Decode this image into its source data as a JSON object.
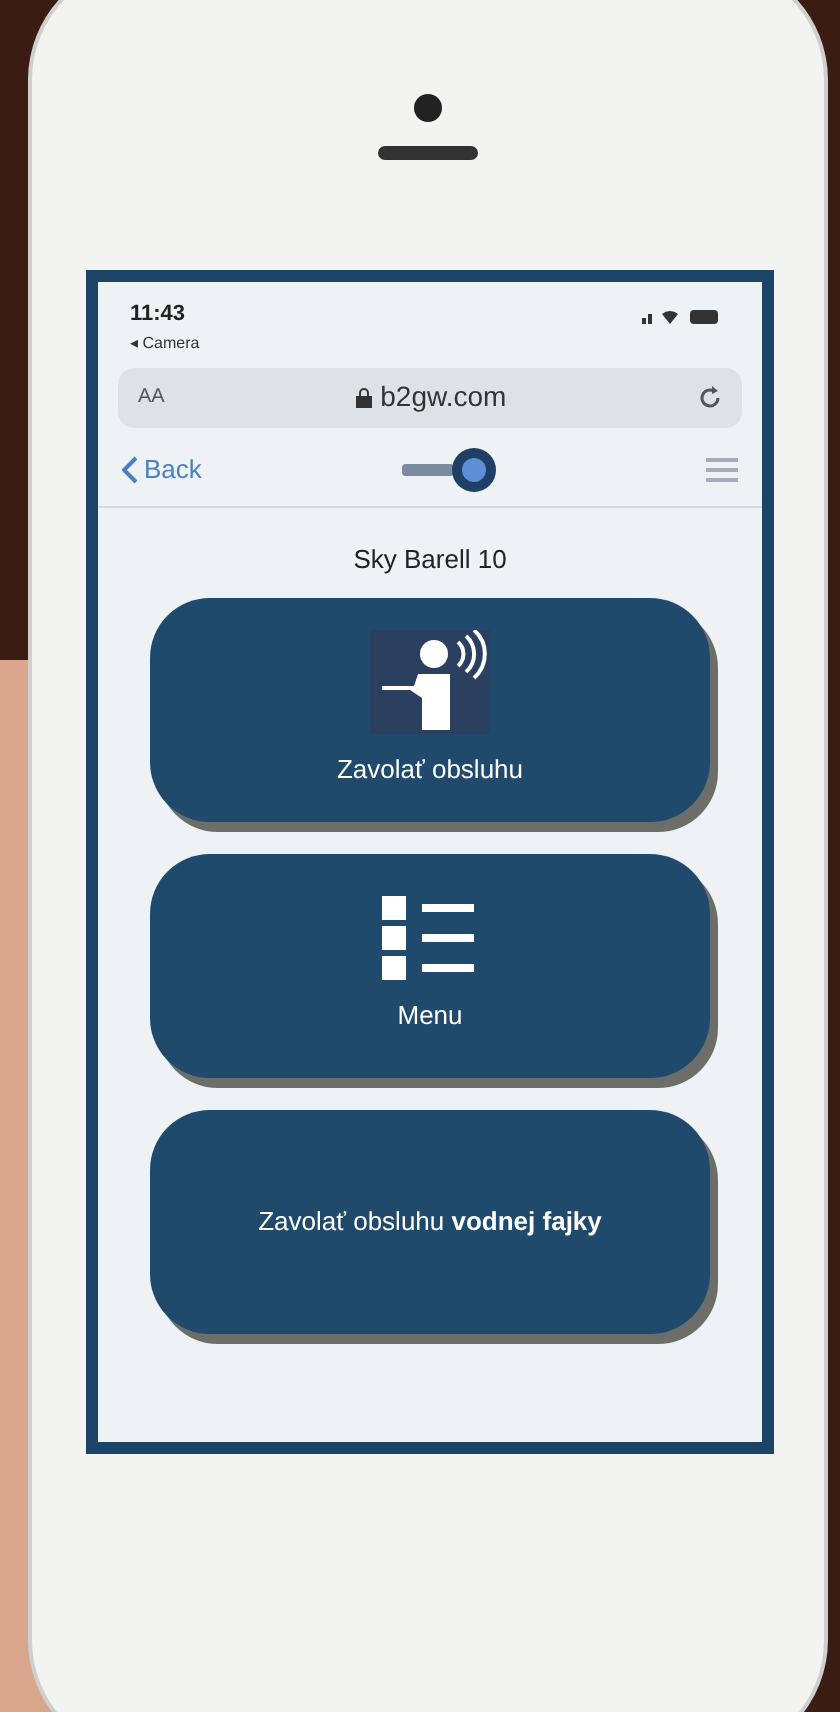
{
  "status_bar": {
    "time": "11:43",
    "back_app": "◂ Camera"
  },
  "address_bar": {
    "text_size": "AA",
    "url": "b2gw.com"
  },
  "nav_bar": {
    "back": "Back"
  },
  "page": {
    "title": "Sky Barell 10",
    "buttons": [
      {
        "kind": "waiter",
        "label": "Zavolať obsluhu"
      },
      {
        "kind": "menu",
        "label": "Menu"
      },
      {
        "kind": "text",
        "label": "Zavolať obsluhu **vodnej fajky**"
      }
    ]
  }
}
